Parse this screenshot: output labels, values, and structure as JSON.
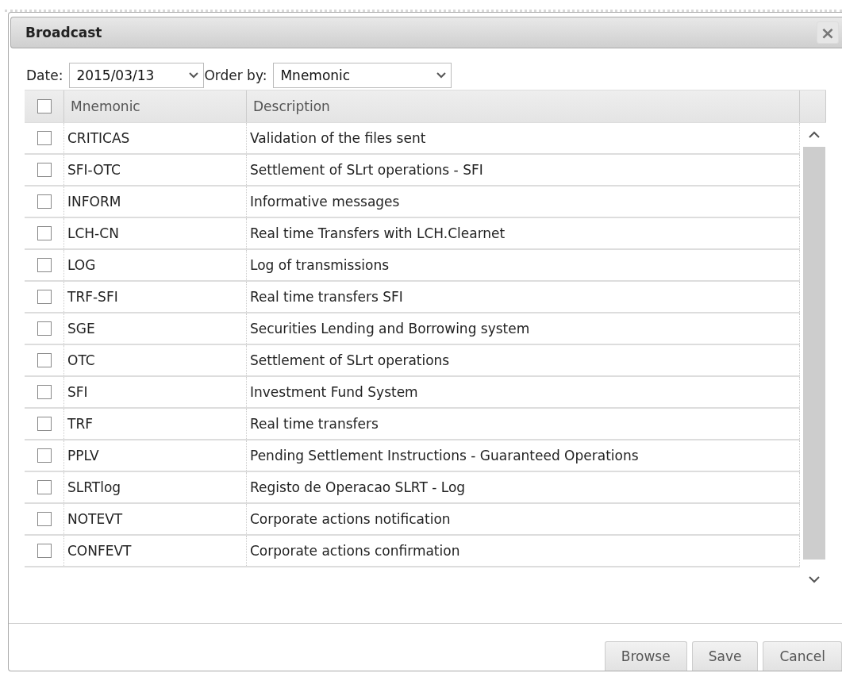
{
  "dialog": {
    "title": "Broadcast",
    "close": "×"
  },
  "filters": {
    "date_label": "Date:",
    "date": "2015/03/13",
    "order_label": "Order by:",
    "order": "Mnemonic"
  },
  "table": {
    "select_all_checked": false,
    "columns": [
      "Mnemonic",
      "Description"
    ],
    "rows": [
      {
        "checked": false,
        "mnemonic": "CRITICAS",
        "description": "Validation of the files sent"
      },
      {
        "checked": false,
        "mnemonic": "SFI-OTC",
        "description": "Settlement of SLrt operations - SFI"
      },
      {
        "checked": false,
        "mnemonic": "INFORM",
        "description": "Informative messages"
      },
      {
        "checked": false,
        "mnemonic": "LCH-CN",
        "description": "Real time Transfers with LCH.Clearnet"
      },
      {
        "checked": false,
        "mnemonic": "LOG",
        "description": "Log of transmissions"
      },
      {
        "checked": false,
        "mnemonic": "TRF-SFI",
        "description": "Real time transfers SFI"
      },
      {
        "checked": false,
        "mnemonic": "SGE",
        "description": "Securities Lending and Borrowing system"
      },
      {
        "checked": false,
        "mnemonic": "OTC",
        "description": "Settlement of SLrt operations"
      },
      {
        "checked": false,
        "mnemonic": "SFI",
        "description": "Investment Fund System"
      },
      {
        "checked": false,
        "mnemonic": "TRF",
        "description": "Real time transfers"
      },
      {
        "checked": false,
        "mnemonic": "PPLV",
        "description": "Pending Settlement Instructions - Guaranteed Operations"
      },
      {
        "checked": false,
        "mnemonic": "SLRTlog",
        "description": "Registo de Operacao SLRT - Log"
      },
      {
        "checked": false,
        "mnemonic": "NOTEVT",
        "description": "Corporate actions notification"
      },
      {
        "checked": false,
        "mnemonic": "CONFEVT",
        "description": "Corporate actions confirmation"
      }
    ]
  },
  "buttons": [
    "Browse",
    "Save",
    "Cancel"
  ]
}
